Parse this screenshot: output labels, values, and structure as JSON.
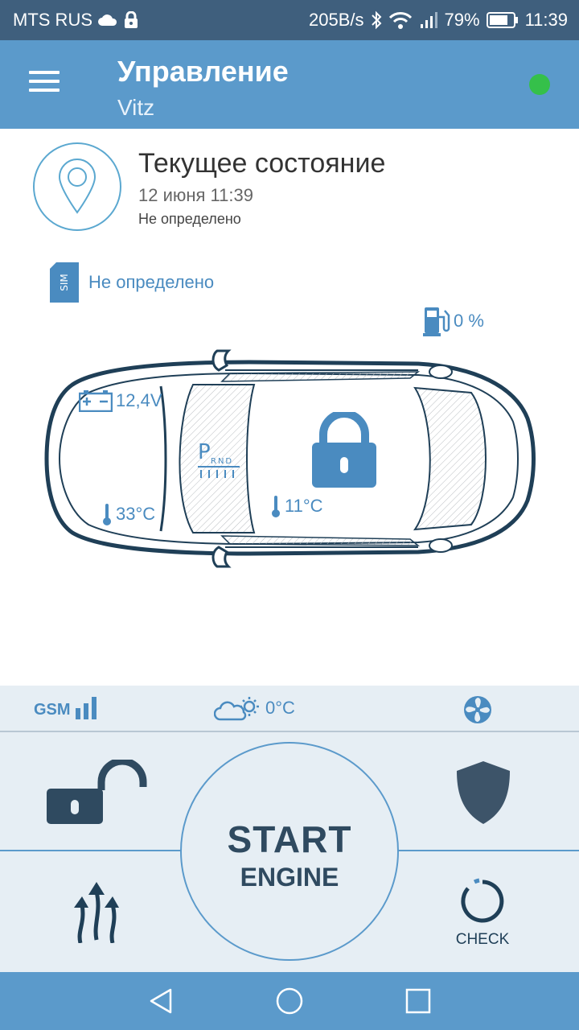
{
  "status_bar": {
    "carrier": "MTS RUS",
    "speed": "205B/s",
    "battery": "79%",
    "time": "11:39"
  },
  "app_bar": {
    "title": "Управление",
    "subtitle": "Vitz",
    "online_color": "#35c04a"
  },
  "state": {
    "title": "Текущее состояние",
    "date": "12 июня 11:39",
    "location": "Не определено",
    "sim_status": "Не определено"
  },
  "car": {
    "fuel": "0 %",
    "battery_voltage": "12,4V",
    "outside_temp": "33°C",
    "inside_temp": "11°C",
    "gear_selected": "P",
    "gear_other": "RND",
    "locked": true
  },
  "info_bar": {
    "gsm_label": "GSM",
    "gsm_signal_level": 3,
    "weather_temp": "0°C"
  },
  "controls": {
    "start_line1": "START",
    "start_line2": "ENGINE",
    "check_label": "CHECK"
  },
  "colors": {
    "primary": "#5b9acb",
    "status_bar": "#3f5f7d",
    "dark_icon": "#2f4a60",
    "text_blue": "#4a8bc0"
  },
  "icons": [
    "menu-icon",
    "location-pin-icon",
    "sim-icon",
    "fuel-icon",
    "battery-icon",
    "thermometer-icon",
    "lock-icon",
    "signal-icon",
    "weather-icon",
    "fan-icon",
    "unlock-icon",
    "shield-icon",
    "heat-icon",
    "check-icon",
    "back-icon",
    "home-icon",
    "recents-icon"
  ]
}
